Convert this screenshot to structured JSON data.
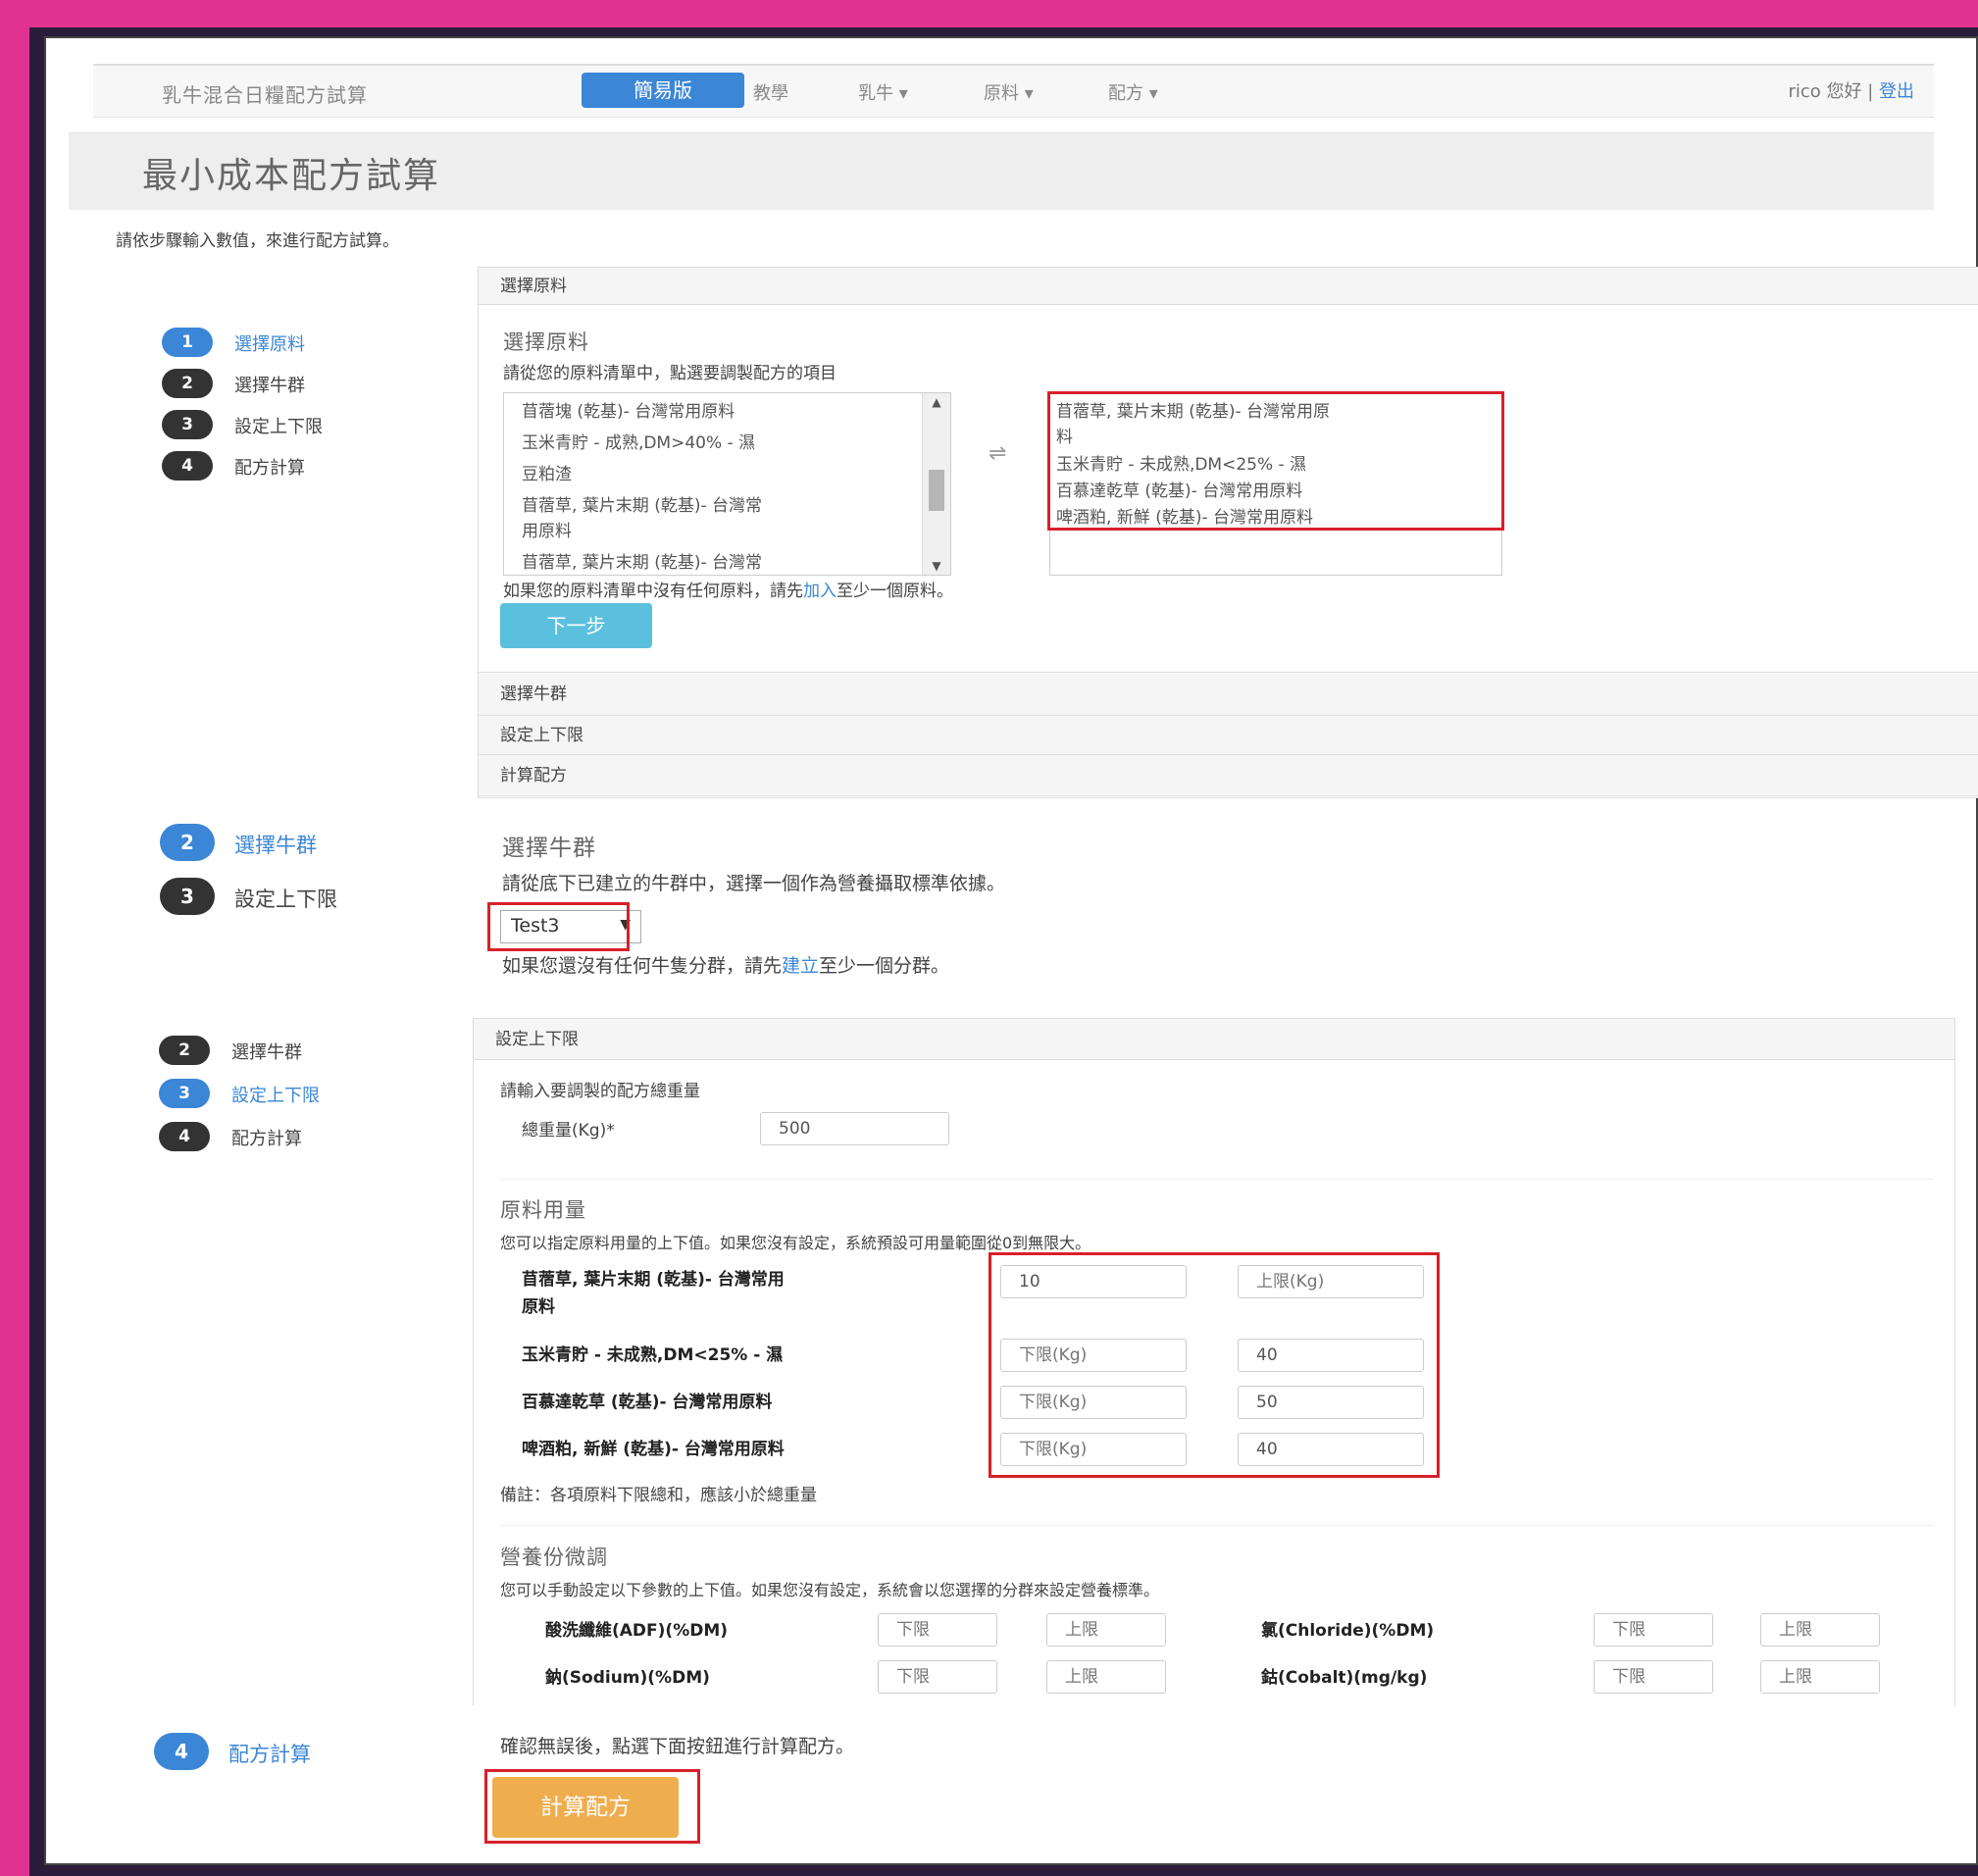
{
  "navbar": {
    "brand": "乳牛混合日糧配方試算",
    "active": "簡易版",
    "items": [
      "教學",
      "乳牛 ▾",
      "原料 ▾",
      "配方 ▾"
    ],
    "user": "rico 您好 | ",
    "logout": "登出"
  },
  "page_title": "最小成本配方試算",
  "sidebar": {
    "intro": "請依步驟輸入數值，來進行配方試算。",
    "steps": [
      {
        "num": "1",
        "label": "選擇原料"
      },
      {
        "num": "2",
        "label": "選擇牛群"
      },
      {
        "num": "3",
        "label": "設定上下限"
      },
      {
        "num": "4",
        "label": "配方計算"
      }
    ]
  },
  "panel1": {
    "head": "選擇原料",
    "section_title": "選擇原料",
    "instruction": "請從您的原料清單中，點選要調製配方的項目",
    "available": [
      "苜蓿塊 (乾基)- 台灣常用原料",
      "玉米青貯 - 成熟,DM>40% - 濕",
      "豆粕渣",
      "苜蓿草, 葉片末期 (乾基)- 台灣常",
      "用原料",
      "苜蓿草, 葉片末期 (乾基)- 台灣常"
    ],
    "selected": [
      "苜蓿草, 葉片末期 (乾基)- 台灣常用原",
      "料",
      "玉米青貯 - 未成熟,DM<25% - 濕",
      "百慕達乾草 (乾基)- 台灣常用原料",
      "啤酒粕, 新鮮 (乾基)- 台灣常用原料"
    ],
    "swap_icon": "⇌",
    "note_before": "如果您的原料清單中沒有任何原料，請先",
    "note_link": "加入",
    "note_after": "至少一個原料。",
    "next_button": "下一步",
    "collapsed": [
      "選擇牛群",
      "設定上下限",
      "計算配方"
    ]
  },
  "panel2": {
    "section_title": "選擇牛群",
    "instruction": "請從底下已建立的牛群中，選擇一個作為營養攝取標準依據。",
    "select_value": "Test3",
    "note_before": "如果您還沒有任何牛隻分群，請先",
    "note_link": "建立",
    "note_after": "至少一個分群。"
  },
  "panel3": {
    "head": "設定上下限",
    "weight_prompt": "請輸入要調製的配方總重量",
    "weight_label": "總重量(Kg)*",
    "weight_value": "500",
    "usage_title": "原料用量",
    "usage_desc": "您可以指定原料用量的上下值。如果您沒有設定，系統預設可用量範圍從0到無限大。",
    "rows": [
      {
        "name": "苜蓿草, 葉片末期 (乾基)- 台灣常用",
        "name2": "原料",
        "lower": "10",
        "upper": "上限(Kg)"
      },
      {
        "name": "玉米青貯 - 未成熟,DM<25% - 濕",
        "name2": "",
        "lower": "下限(Kg)",
        "upper": "40"
      },
      {
        "name": "百慕達乾草 (乾基)- 台灣常用原料",
        "name2": "",
        "lower": "下限(Kg)",
        "upper": "50"
      },
      {
        "name": "啤酒粕, 新鮮 (乾基)- 台灣常用原料",
        "name2": "",
        "lower": "下限(Kg)",
        "upper": "40"
      }
    ],
    "remark": "備註：各項原料下限總和，應該小於總重量",
    "nutrient_title": "營養份微調",
    "nutrient_desc": "您可以手動設定以下參數的上下值。如果您沒有設定，系統會以您選擇的分群來設定營養標準。",
    "nutrients": [
      {
        "name": "酸洗纖維(ADF)(%DM)",
        "lower": "下限",
        "upper": "上限"
      },
      {
        "name": "氯(Chloride)(%DM)",
        "lower": "下限",
        "upper": "上限"
      },
      {
        "name": "鈉(Sodium)(%DM)",
        "lower": "下限",
        "upper": "上限"
      },
      {
        "name": "鈷(Cobalt)(mg/kg)",
        "lower": "下限",
        "upper": "上限"
      }
    ]
  },
  "panel4": {
    "instruction": "確認無誤後，點選下面按鈕進行計算配方。",
    "calc_button": "計算配方"
  }
}
